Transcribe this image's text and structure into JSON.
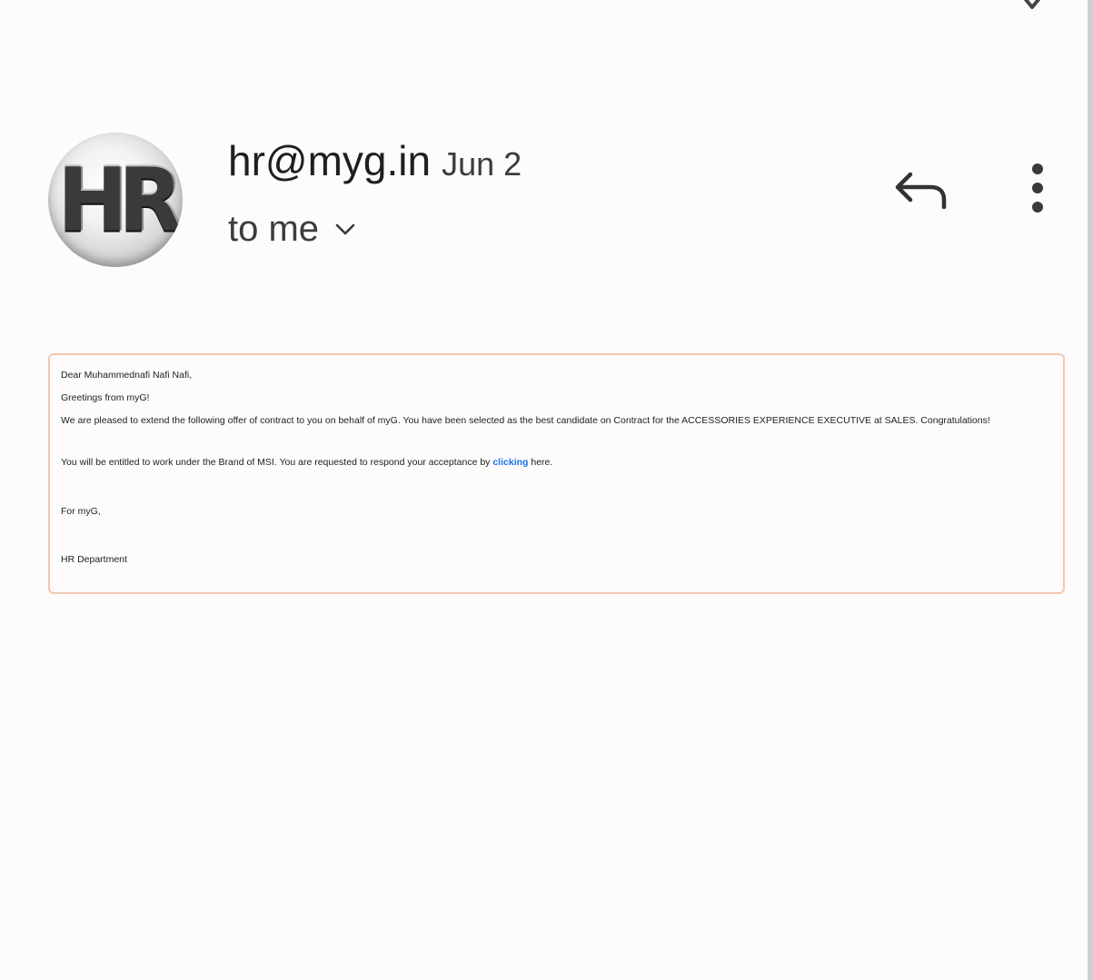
{
  "header": {
    "avatar_text": "HR",
    "sender": "hr@myg.in",
    "date": "Jun 2",
    "recipient": "to me"
  },
  "icons": {
    "star": "star-icon",
    "reply": "reply-icon",
    "more": "more-vert-icon",
    "expand": "chevron-down-icon"
  },
  "message": {
    "greeting": "Dear Muhammednafi Nafi Nafi,",
    "greeting_line2": "Greetings from myG!",
    "offer": "We are pleased to extend the following offer of contract to you on behalf of myG. You have been selected as the best candidate on Contract for the ACCESSORIES EXPERIENCE EXECUTIVE at SALES. Congratulations!",
    "entitled_before": "You will be entitled to work under the Brand of MSI. You are requested to respond your acceptance by ",
    "link_text": "clicking",
    "entitled_after": " here.",
    "closing": "For myG,",
    "signature": "HR Department"
  },
  "colors": {
    "background": "#fdfbfc",
    "frame_border": "#f3c7ae",
    "link": "#1a73e8",
    "text": "#1f1f1f"
  }
}
